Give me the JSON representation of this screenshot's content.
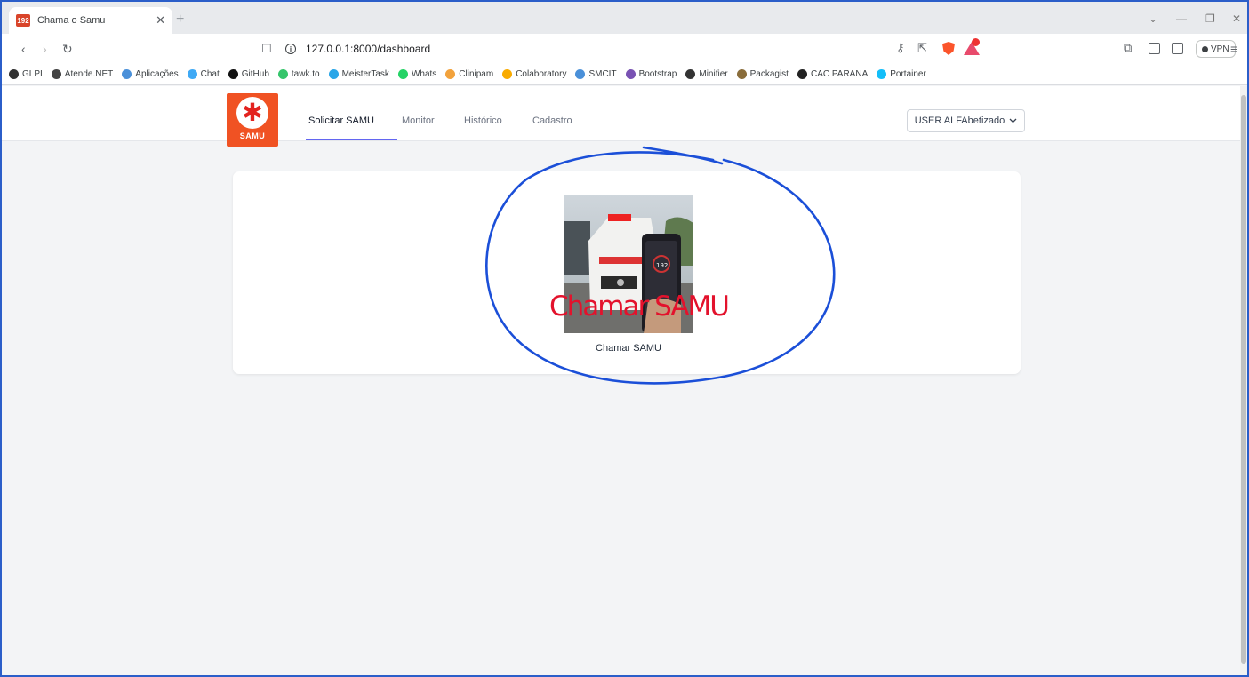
{
  "browser": {
    "tab_title": "Chama o Samu",
    "tab_favicon_text": "192",
    "url": "127.0.0.1:8000/dashboard",
    "vpn_label": "VPN",
    "bookmarks": [
      {
        "label": "GLPI",
        "color": "#333333"
      },
      {
        "label": "Atende.NET",
        "color": "#444444"
      },
      {
        "label": "Aplicações",
        "color": "#4a90d9"
      },
      {
        "label": "Chat",
        "color": "#3fa9f5"
      },
      {
        "label": "GitHub",
        "color": "#111111"
      },
      {
        "label": "tawk.to",
        "color": "#35c56b"
      },
      {
        "label": "MeisterTask",
        "color": "#2aa6e8"
      },
      {
        "label": "Whats",
        "color": "#25d366"
      },
      {
        "label": "Clinipam",
        "color": "#f2a23c"
      },
      {
        "label": "Colaboratory",
        "color": "#f9ab00"
      },
      {
        "label": "SMCIT",
        "color": "#4a90d9"
      },
      {
        "label": "Bootstrap",
        "color": "#7952b3"
      },
      {
        "label": "Minifier",
        "color": "#333333"
      },
      {
        "label": "Packagist",
        "color": "#8a6d3b"
      },
      {
        "label": "CAC PARANA",
        "color": "#222222"
      },
      {
        "label": "Portainer",
        "color": "#13bef9"
      }
    ]
  },
  "app": {
    "logo_text": "SAMU",
    "nav": {
      "items": [
        {
          "label": "Solicitar SAMU",
          "active": true
        },
        {
          "label": "Monitor",
          "active": false
        },
        {
          "label": "Histórico",
          "active": false
        },
        {
          "label": "Cadastro",
          "active": false
        }
      ]
    },
    "user_menu_label": "USER ALFAbetizado",
    "card": {
      "image_overlay_text": "Chamar SAMU",
      "label": "Chamar SAMU"
    }
  },
  "colors": {
    "accent": "#6366f1",
    "brand": "#f05223",
    "annotation": "#1b4fd8"
  }
}
